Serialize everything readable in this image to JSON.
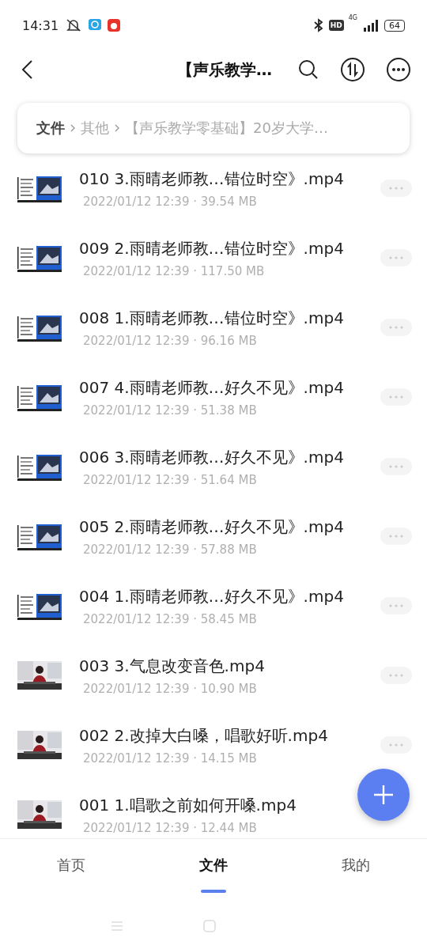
{
  "status_bar": {
    "time": "14:31",
    "hd": "HD",
    "network": "4G",
    "battery": "64"
  },
  "header": {
    "title": "【声乐教学…"
  },
  "breadcrumb": [
    {
      "label": "文件",
      "current": true
    },
    {
      "label": "其他",
      "current": false
    },
    {
      "label": "【声乐教学零基础】20岁大学…",
      "current": false
    }
  ],
  "files": [
    {
      "name": "010 3.雨晴老师教…错位时空》.mp4",
      "meta": "2022/01/12 12:39 · 39.54 MB"
    },
    {
      "name": "009 2.雨晴老师教…错位时空》.mp4",
      "meta": "2022/01/12 12:39 · 117.50 MB"
    },
    {
      "name": "008 1.雨晴老师教…错位时空》.mp4",
      "meta": "2022/01/12 12:39 · 96.16 MB"
    },
    {
      "name": "007 4.雨晴老师教…好久不见》.mp4",
      "meta": "2022/01/12 12:39 · 51.38 MB"
    },
    {
      "name": "006 3.雨晴老师教…好久不见》.mp4",
      "meta": "2022/01/12 12:39 · 51.64 MB"
    },
    {
      "name": "005 2.雨晴老师教…好久不见》.mp4",
      "meta": "2022/01/12 12:39 · 57.88 MB"
    },
    {
      "name": "004 1.雨晴老师教…好久不见》.mp4",
      "meta": "2022/01/12 12:39 · 58.45 MB"
    },
    {
      "name": "003 3.气息改变音色.mp4",
      "meta": "2022/01/12 12:39 · 10.90 MB"
    },
    {
      "name": "002 2.改掉大白嗓，唱歌好听.mp4",
      "meta": "2022/01/12 12:39 · 14.15 MB"
    },
    {
      "name": "001 1.唱歌之前如何开嗓.mp4",
      "meta": "2022/01/12 12:39 · 12.44 MB"
    }
  ],
  "tabs": [
    {
      "label": "首页",
      "selected": false
    },
    {
      "label": "文件",
      "selected": true
    },
    {
      "label": "我的",
      "selected": false
    }
  ]
}
